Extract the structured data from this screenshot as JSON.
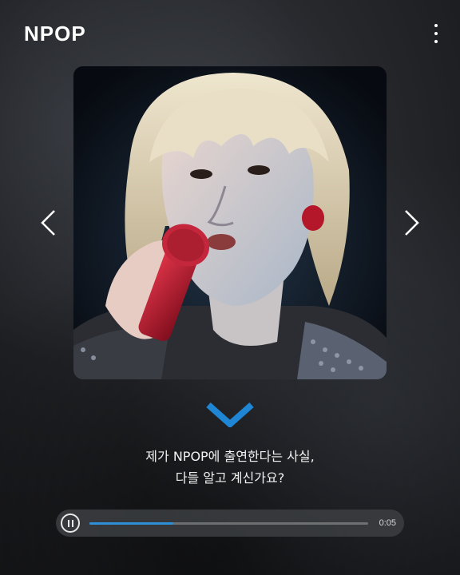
{
  "app": {
    "logo_text": "NPOP"
  },
  "colors": {
    "accent": "#2e8fd6",
    "chevron": "#1f86d6",
    "background": "#26282c"
  },
  "icons": {
    "menu": "more-vertical-icon",
    "prev": "chevron-left-icon",
    "next": "chevron-right-icon",
    "scroll": "chevron-down-icon",
    "pause": "pause-icon"
  },
  "caption": {
    "line1": "제가 NPOP에 출연한다는 사실,",
    "line2": "다들 알고 계신가요?"
  },
  "player": {
    "time": "0:05",
    "progress": 0.3
  }
}
